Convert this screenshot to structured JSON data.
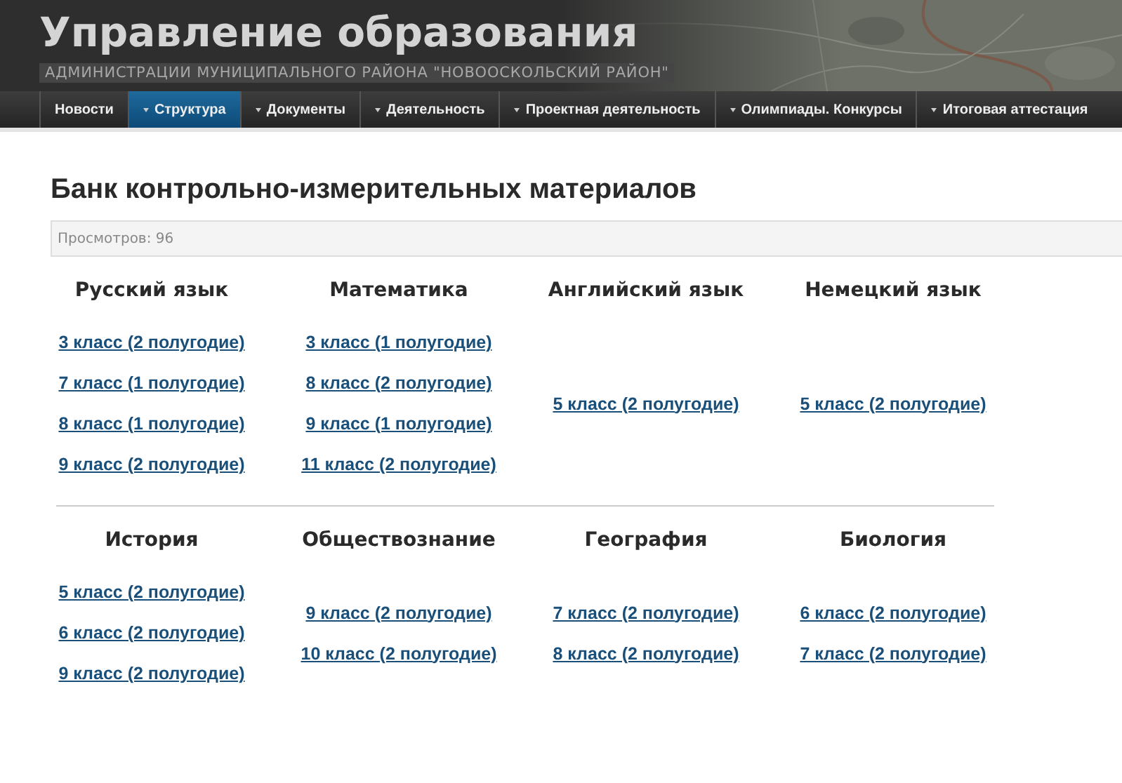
{
  "header": {
    "title": "Управление образования",
    "subtitle": "АДМИНИСТРАЦИИ МУНИЦИПАЛЬНОГО РАЙОНА \"НОВООСКОЛЬСКИЙ РАЙОН\""
  },
  "nav": [
    {
      "label": "Новости",
      "dropdown": false,
      "selected": false
    },
    {
      "label": "Структура",
      "dropdown": true,
      "selected": true
    },
    {
      "label": "Документы",
      "dropdown": true,
      "selected": false
    },
    {
      "label": "Деятельность",
      "dropdown": true,
      "selected": false
    },
    {
      "label": "Проектная деятельность",
      "dropdown": true,
      "selected": false
    },
    {
      "label": "Олимпиады. Конкурсы",
      "dropdown": true,
      "selected": false
    },
    {
      "label": "Итоговая аттестация",
      "dropdown": true,
      "selected": false
    }
  ],
  "page_title": "Банк контрольно-измерительных материалов",
  "views": "Просмотров: 96",
  "sections": [
    {
      "subjects": [
        {
          "name": "Русский язык",
          "links": [
            "3 класс (2 полугодие)",
            "7 класс (1 полугодие)",
            "8 класс (1 полугодие)",
            "9 класс (2 полугодие)"
          ]
        },
        {
          "name": "Математика",
          "links": [
            "3 класс (1 полугодие)",
            "8 класс (2 полугодие)",
            "9 класс (1 полугодие)",
            "11 класс (2 полугодие)"
          ]
        },
        {
          "name": "Английский язык",
          "links": [
            "5 класс (2 полугодие)"
          ]
        },
        {
          "name": "Немецкий язык",
          "links": [
            "5 класс (2 полугодие)"
          ]
        }
      ]
    },
    {
      "subjects": [
        {
          "name": "История",
          "links": [
            "5 класс (2 полугодие)",
            "6 класс (2 полугодие)",
            "9 класс (2 полугодие)"
          ]
        },
        {
          "name": "Обществознание",
          "links": [
            "9 класс (2 полугодие)",
            "10 класс (2 полугодие)"
          ]
        },
        {
          "name": "География",
          "links": [
            "7 класс (2 полугодие)",
            "8 класс (2 полугодие)"
          ]
        },
        {
          "name": "Биология",
          "links": [
            "6 класс (2 полугодие)",
            "7 класс (2 полугодие)"
          ]
        }
      ]
    }
  ]
}
